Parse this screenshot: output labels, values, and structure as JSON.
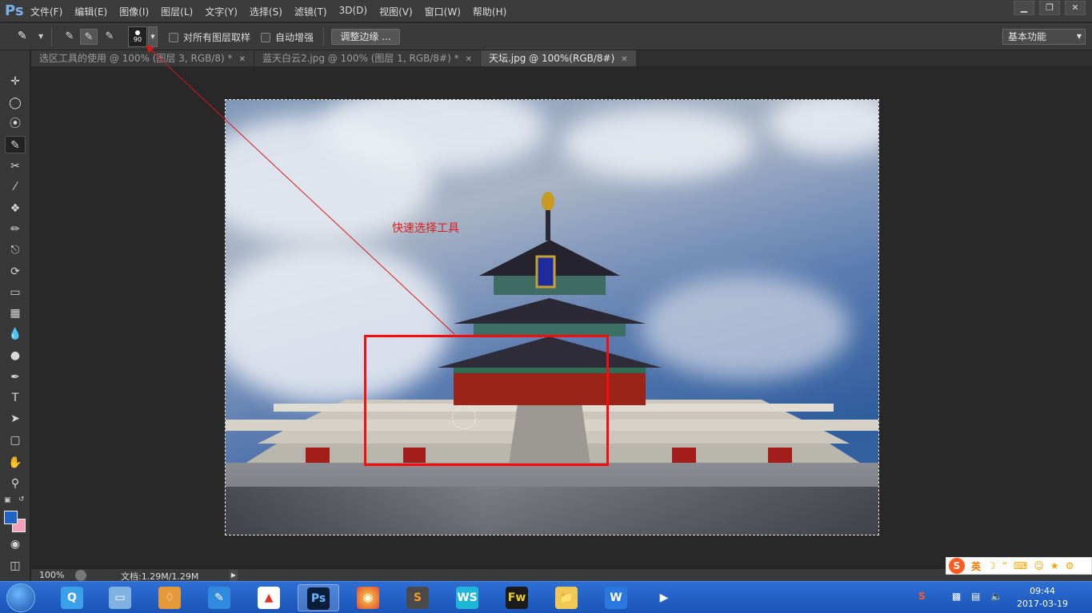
{
  "app": {
    "logo": "Ps"
  },
  "menu": [
    "文件(F)",
    "编辑(E)",
    "图像(I)",
    "图层(L)",
    "文字(Y)",
    "选择(S)",
    "滤镜(T)",
    "3D(D)",
    "视图(V)",
    "窗口(W)",
    "帮助(H)"
  ],
  "window_buttons": {
    "minimize": "▁",
    "restore": "❐",
    "close": "✕"
  },
  "options": {
    "brush_size": "90",
    "sample_all_layers": "对所有图层取样",
    "auto_enhance": "自动增强",
    "refine_edge": "调整边缘 ...",
    "workspace": "基本功能"
  },
  "tabs": [
    {
      "label": "选区工具的使用 @ 100% (图层 3, RGB/8) *",
      "active": false
    },
    {
      "label": "蓝天白云2.jpg @ 100% (图层 1, RGB/8#) *",
      "active": false
    },
    {
      "label": "天坛.jpg @ 100%(RGB/8#)",
      "active": true
    }
  ],
  "annotation": {
    "label": "快速选择工具",
    "color": "#ff0a0a"
  },
  "status": {
    "zoom": "100%",
    "doc": "文档:1.29M/1.29M"
  },
  "colors": {
    "foreground": "#1f64c4",
    "background": "#f3a0b8"
  },
  "tools": [
    "move-tool",
    "marquee-tool",
    "lasso-tool",
    "quick-selection-tool",
    "crop-tool",
    "eyedropper-tool",
    "healing-brush-tool",
    "brush-tool",
    "clone-stamp-tool",
    "history-brush-tool",
    "eraser-tool",
    "gradient-tool",
    "blur-tool",
    "dodge-tool",
    "pen-tool",
    "type-tool",
    "path-selection-tool",
    "rectangle-tool",
    "hand-tool",
    "zoom-tool"
  ],
  "ime": {
    "mode": "英"
  },
  "clock": {
    "time": "09:44",
    "date": "2017-03-19"
  }
}
